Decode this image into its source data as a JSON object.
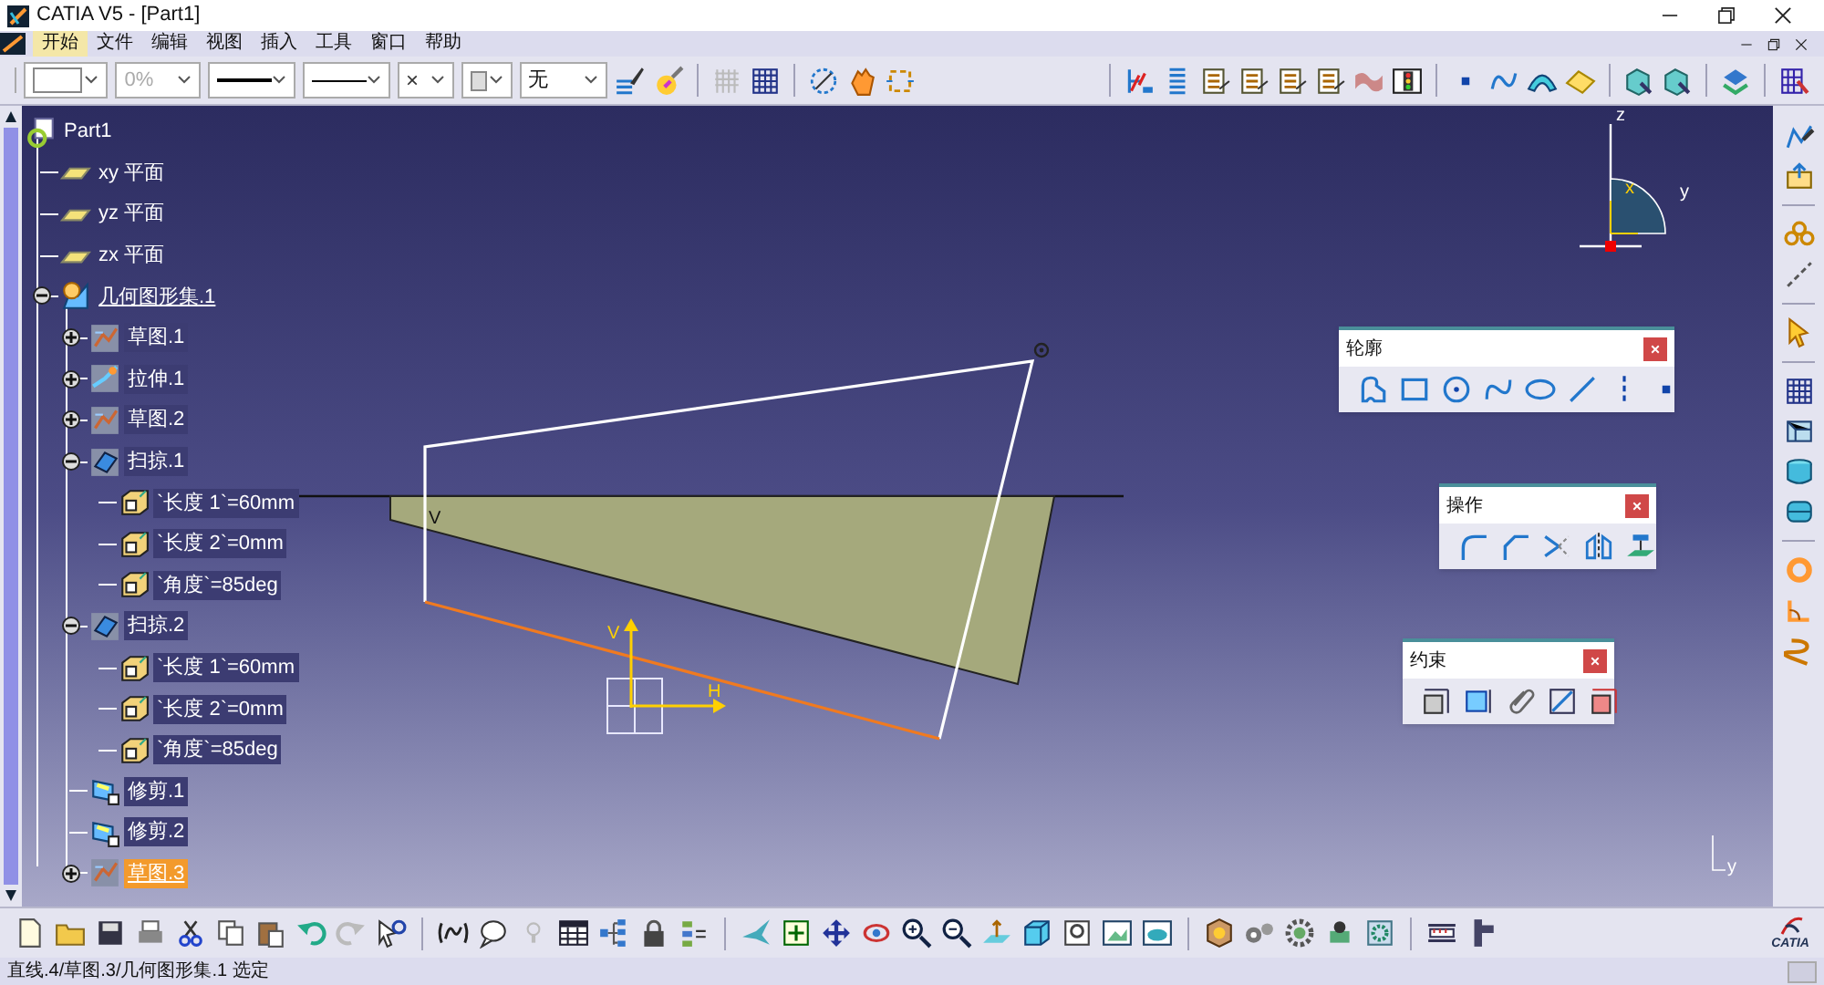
{
  "window": {
    "title": "CATIA V5 - [Part1]"
  },
  "menu": [
    {
      "label": "开始",
      "selected": true
    },
    {
      "label": "文件",
      "selected": false
    },
    {
      "label": "编辑",
      "selected": false
    },
    {
      "label": "视图",
      "selected": false
    },
    {
      "label": "插入",
      "selected": false
    },
    {
      "label": "工具",
      "selected": false
    },
    {
      "label": "窗口",
      "selected": false
    },
    {
      "label": "帮助",
      "selected": false
    }
  ],
  "toolbar": {
    "transparency": {
      "value": "0%",
      "disabled": true
    },
    "point_symbol": "×",
    "layer": "无"
  },
  "tree": {
    "label": "Part1",
    "kind": "part",
    "selected": false,
    "in_work": false,
    "children": [
      {
        "label": "xy 平面",
        "kind": "plane",
        "selected": false,
        "in_work": false
      },
      {
        "label": "yz 平面",
        "kind": "plane",
        "selected": false,
        "in_work": false
      },
      {
        "label": "zx 平面",
        "kind": "plane",
        "selected": false,
        "in_work": false
      },
      {
        "label": "几何图形集.1",
        "kind": "set",
        "selected": false,
        "in_work": true,
        "expanded": true,
        "children": [
          {
            "label": "草图.1",
            "kind": "sketch",
            "selected": false,
            "in_work": false,
            "expanded": false
          },
          {
            "label": "拉伸.1",
            "kind": "extrude",
            "selected": false,
            "in_work": false,
            "expanded": false
          },
          {
            "label": "草图.2",
            "kind": "sketch",
            "selected": false,
            "in_work": false,
            "expanded": false
          },
          {
            "label": "扫掠.1",
            "kind": "sweep",
            "selected": false,
            "in_work": false,
            "expanded": true,
            "children": [
              {
                "label": "`长度 1`=60mm",
                "kind": "parameter",
                "selected": false,
                "in_work": false
              },
              {
                "label": "`长度 2`=0mm",
                "kind": "parameter",
                "selected": false,
                "in_work": false
              },
              {
                "label": "`角度`=85deg",
                "kind": "parameter",
                "selected": false,
                "in_work": false
              }
            ]
          },
          {
            "label": "扫掠.2",
            "kind": "sweep",
            "selected": false,
            "in_work": false,
            "expanded": true,
            "children": [
              {
                "label": "`长度 1`=60mm",
                "kind": "parameter",
                "selected": false,
                "in_work": false
              },
              {
                "label": "`长度 2`=0mm",
                "kind": "parameter",
                "selected": false,
                "in_work": false
              },
              {
                "label": "`角度`=85deg",
                "kind": "parameter",
                "selected": false,
                "in_work": false
              }
            ]
          },
          {
            "label": "修剪.1",
            "kind": "trim",
            "selected": false,
            "in_work": false
          },
          {
            "label": "修剪.2",
            "kind": "trim",
            "selected": false,
            "in_work": false
          },
          {
            "label": "草图.3",
            "kind": "sketch",
            "selected": true,
            "in_work": false,
            "expanded": false
          }
        ]
      }
    ]
  },
  "floating_toolbars": [
    {
      "title": "轮廓"
    },
    {
      "title": "操作"
    },
    {
      "title": "约束"
    }
  ],
  "canvas": {
    "corner_label": "V",
    "v_axis_label": "V",
    "h_axis_label": "H",
    "compass": {
      "z": "z",
      "x": "x",
      "y": "y"
    },
    "axis_indicator": "y"
  },
  "logo": {
    "text": "CATIA"
  },
  "status_bar": {
    "text": "直线.4/草图.3/几何图形集.1 选定"
  }
}
